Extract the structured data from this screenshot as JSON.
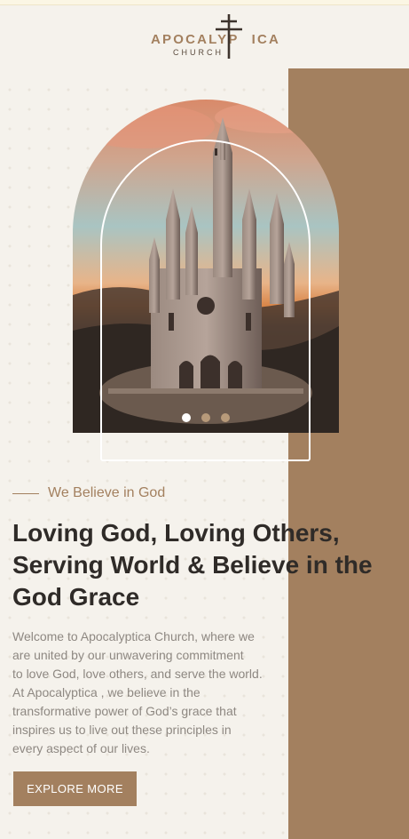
{
  "logo": {
    "name_part1": "APOCALYP",
    "name_part2": "ICA",
    "subtitle": "CHURCH"
  },
  "hero": {
    "image_alt": "cathedral-on-hill-photo",
    "carousel": {
      "slide_count": 3,
      "active_index": 0
    }
  },
  "eyebrow": "We Believe in God",
  "headline": [
    "Loving God, Loving Others,",
    "Serving World & Believe in the",
    "God Grace"
  ],
  "body": [
    "Welcome to Apocalyptica Church, where we",
    "are united by our unwavering commitment",
    "to love God, love others, and serve the world.",
    "At Apocalyptica , we believe in the",
    "transformative power of God’s grace that",
    "inspires us to live out these principles in",
    "every aspect of our lives."
  ],
  "cta_label": "EXPLORE MORE",
  "colors": {
    "accent": "#a3805f",
    "background": "#f5f2ec",
    "heading": "#2f2b28",
    "body": "#8e8882"
  }
}
